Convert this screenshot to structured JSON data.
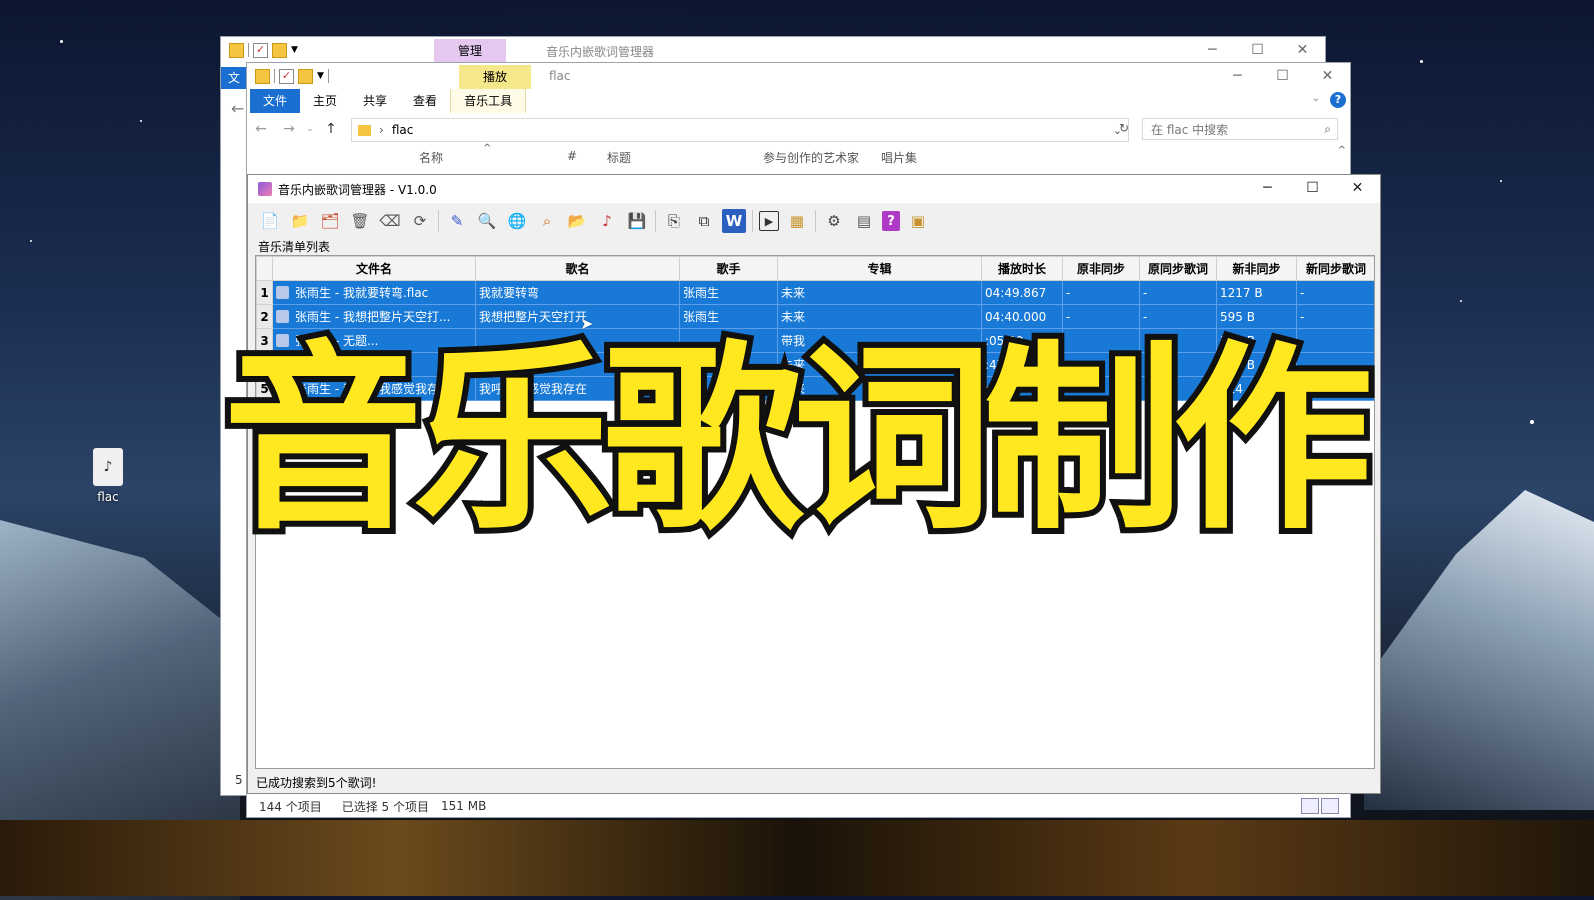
{
  "desktop": {
    "icon_label": "flac"
  },
  "back_explorer": {
    "context_tab": "管理",
    "title": "音乐内嵌歌词管理器",
    "side_letter": "文",
    "side_count": "5"
  },
  "explorer": {
    "context_tab": "播放",
    "title": "flac",
    "ribbon_tabs": [
      "文件",
      "主页",
      "共享",
      "查看",
      "音乐工具"
    ],
    "address": "flac",
    "search_placeholder": "在 flac 中搜索",
    "columns": [
      "名称",
      "#",
      "标题",
      "参与创作的艺术家",
      "唱片集"
    ],
    "status": {
      "items": "144 个项目",
      "selected": "已选择 5 个项目",
      "size": "151 MB"
    }
  },
  "app": {
    "title": "音乐内嵌歌词管理器  - V1.0.0",
    "group_label": "音乐清单列表",
    "columns": [
      "文件名",
      "歌名",
      "歌手",
      "专辑",
      "播放时长",
      "原非同步",
      "原同步歌词",
      "新非同步",
      "新同步歌词"
    ],
    "rows": [
      {
        "n": "1",
        "file": "张雨生 - 我就要转弯.flac",
        "title": "我就要转弯",
        "artist": "张雨生",
        "album": "未来",
        "dur": "04:49.867",
        "c1": "-",
        "c2": "-",
        "c3": "1217 B",
        "c4": "-"
      },
      {
        "n": "2",
        "file": "张雨生 - 我想把整片天空打...",
        "title": "我想把整片天空打开",
        "artist": "张雨生",
        "album": "未来",
        "dur": "04:40.000",
        "c1": "-",
        "c2": "-",
        "c3": "595 B",
        "c4": "-"
      },
      {
        "n": "3",
        "file": "张雨生 - 无题...",
        "title": "",
        "artist": "",
        "album": "带我",
        "dur": ":05.00",
        "c1": "",
        "c2": "",
        "c3": "373 B",
        "c4": ""
      },
      {
        "n": "4",
        "file": "张雨生 - 现...",
        "title": "",
        "artist": "",
        "album": "未来",
        "dur": ":47.",
        "c1": "",
        "c2": "",
        "c3": "608 B",
        "c4": ""
      },
      {
        "n": "5",
        "file": "张雨生 - 我呼吸我感觉我存在",
        "title": "我呼吸我感觉我存在",
        "artist": "",
        "album": "未来",
        "dur": ":29",
        "c1": "",
        "c2": "",
        "c3": "514",
        "c4": ""
      }
    ],
    "status": "已成功搜索到5个歌词!"
  },
  "banner": "音乐歌词制作",
  "colors": {
    "accent": "#1a6fd1",
    "selection": "#1879d6",
    "banner_fill": "#ffe81f",
    "banner_stroke": "#111111"
  }
}
